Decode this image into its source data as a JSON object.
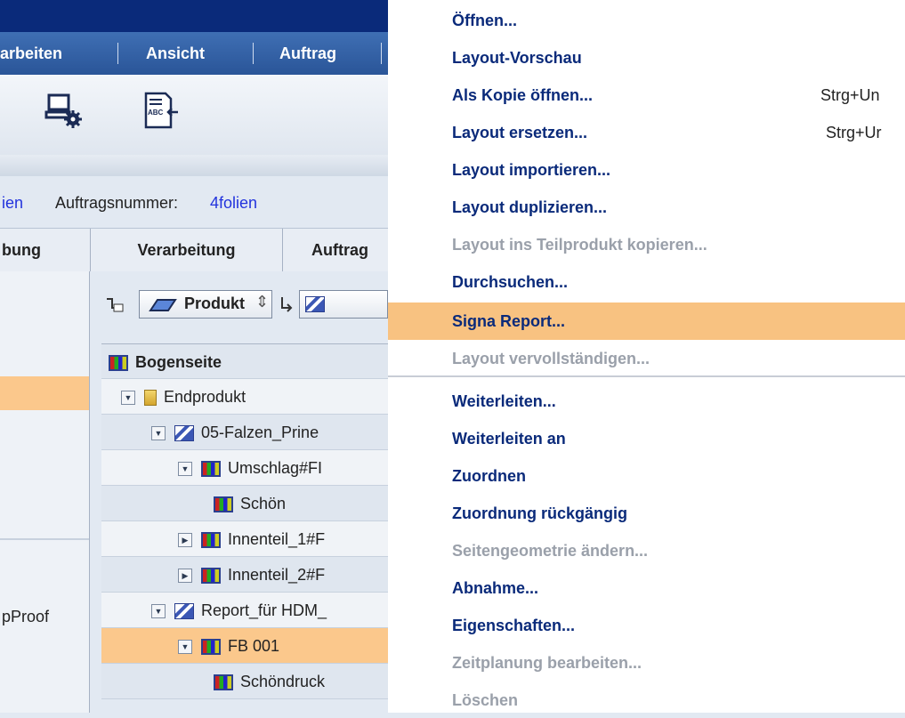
{
  "menubar": {
    "items": [
      "arbeiten",
      "Ansicht",
      "Auftrag"
    ]
  },
  "infobar": {
    "prefix": "ien",
    "label": "Auftragsnummer:",
    "value": "4folien"
  },
  "tabs": [
    "bung",
    "Verarbeitung",
    "Auftrag"
  ],
  "left_panel": {
    "item": "pProof"
  },
  "tree_toolbar": {
    "selector_label": "Produkt"
  },
  "tree": {
    "header": "Bogenseite",
    "rows": [
      {
        "label": "Endprodukt"
      },
      {
        "label": "05-Falzen_Prine"
      },
      {
        "label": "Umschlag#FI"
      },
      {
        "label": "Schön"
      },
      {
        "label": "Innenteil_1#F"
      },
      {
        "label": "Innenteil_2#F"
      },
      {
        "label": "Report_für HDM_"
      },
      {
        "label": "FB 001"
      },
      {
        "label": "Schöndruck"
      }
    ]
  },
  "context_menu": {
    "items": [
      {
        "label": "Öffnen...",
        "enabled": true
      },
      {
        "label": "Layout-Vorschau",
        "enabled": true
      },
      {
        "label": "Als Kopie öffnen...",
        "enabled": true,
        "shortcut": "Strg+Un"
      },
      {
        "label": "Layout ersetzen...",
        "enabled": true,
        "shortcut": "Strg+Ur"
      },
      {
        "label": "Layout importieren...",
        "enabled": true
      },
      {
        "label": "Layout duplizieren...",
        "enabled": true
      },
      {
        "label": "Layout ins Teilprodukt kopieren...",
        "enabled": false
      },
      {
        "label": "Durchsuchen...",
        "enabled": true
      },
      {
        "label": "Signa Report...",
        "enabled": true,
        "highlighted": true
      },
      {
        "label": "Layout vervollständigen...",
        "enabled": false
      },
      {
        "label": "Weiterleiten...",
        "enabled": true
      },
      {
        "label": "Weiterleiten an",
        "enabled": true
      },
      {
        "label": "Zuordnen",
        "enabled": true
      },
      {
        "label": "Zuordnung rückgängig",
        "enabled": true
      },
      {
        "label": "Seitengeometrie ändern...",
        "enabled": false
      },
      {
        "label": "Abnahme...",
        "enabled": true
      },
      {
        "label": "Eigenschaften...",
        "enabled": true
      },
      {
        "label": "Zeitplanung bearbeiten...",
        "enabled": false
      },
      {
        "label": "Löschen",
        "enabled": false
      }
    ]
  },
  "colors": {
    "menubar": "#2a5598",
    "selection": "#fbc88c",
    "menu_highlight": "#f8c281",
    "menu_text": "#0a2a7a",
    "menu_disabled": "#9aa0aa"
  }
}
